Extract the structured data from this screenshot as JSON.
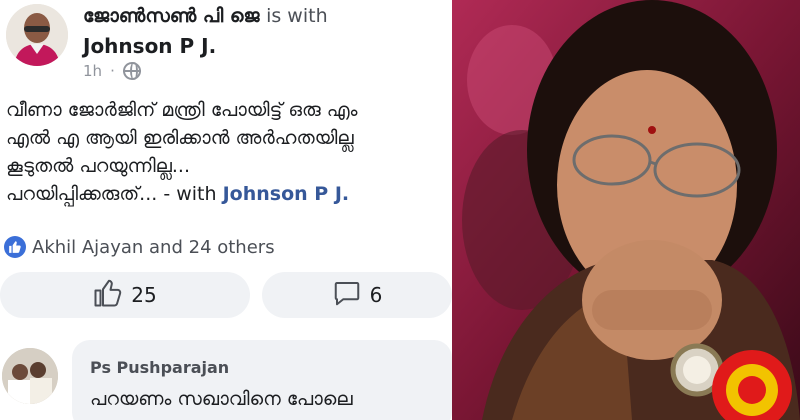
{
  "post": {
    "author": "ജോൺസൺ പി ജെ",
    "is_with": "is with",
    "tagged": "Johnson P J.",
    "time": "1h",
    "dot": "·",
    "privacy_icon": "globe-icon",
    "body_lines": [
      "വീണാ ജോർജിന് മന്ത്രി പോയിട്ട് ഒരു എം",
      "എൽ എ ആയി ഇരിക്കാൻ അർഹതയില്ല",
      "കൂടുതൽ പറയുന്നില്ല...",
      "പറയിപ്പിക്കരുത്..."
    ],
    "with_prefix": "- with",
    "with_name": "Johnson P J."
  },
  "reactions": {
    "icon": "like-badge-icon",
    "text": "Akhil Ajayan and 24 others"
  },
  "actions": {
    "like_icon": "thumbs-up-icon",
    "like_count": "25",
    "comment_icon": "comment-icon",
    "comment_count": "6"
  },
  "comment": {
    "author": "Ps Pushparajan",
    "text": "പറയണം സഖാവിനെ പോലെ"
  },
  "colors": {
    "link_blue": "#365899",
    "like_blue": "#3b6fd8",
    "button_bg": "#f0f2f5",
    "photo_bg": "#8a1d3e"
  }
}
